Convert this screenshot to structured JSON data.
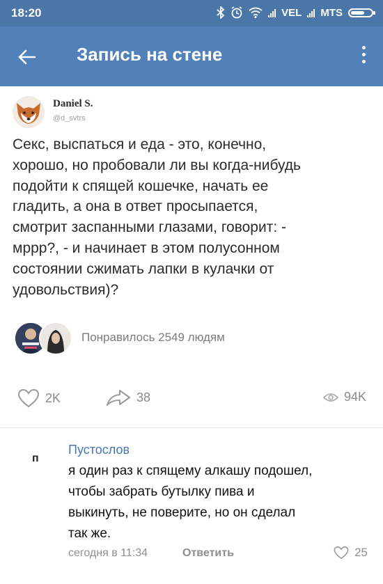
{
  "status_bar": {
    "time": "18:20",
    "carrier1": "VEL",
    "carrier2": "MTS",
    "icons": [
      "bluetooth-icon",
      "alarm-icon",
      "wifi-icon",
      "signal-icon",
      "battery-icon"
    ]
  },
  "app_bar": {
    "title": "Запись на стене",
    "back_icon": "arrow-left-icon",
    "menu_icon": "more-vertical-icon"
  },
  "post": {
    "author": "Daniel S.",
    "handle": "@d_svtrs",
    "text": "Секс, выспаться и еда - это, конечно,\nхорошо, но пробовали ли вы когда-нибудь\nподойти к спящей кошечке, начать ее\nгладить, а она в ответ просыпается,\nсмотрит заспанными глазами, говорит: -\nмррр?, - и начинает в этом полусонном\nсостоянии сжимать лапки в кулачки от\nудовольствия)?",
    "liked_by": "Понравилось 2549 людям",
    "likes": "2K",
    "shares": "38",
    "views": "94K"
  },
  "comment": {
    "avatar_letter": "п",
    "author": "Пустослов",
    "text": "я один раз к спящему алкашу подошел,\nчтобы забрать бутылку пива и\nвыкинуть, не поверите, но он сделал\nтак же.",
    "time": "сегодня в 11:34",
    "reply": "Ответить",
    "likes": "25"
  },
  "colors": {
    "status_bar": "#4a76a8",
    "app_bar": "#5181b8",
    "link": "#4a76a8"
  }
}
